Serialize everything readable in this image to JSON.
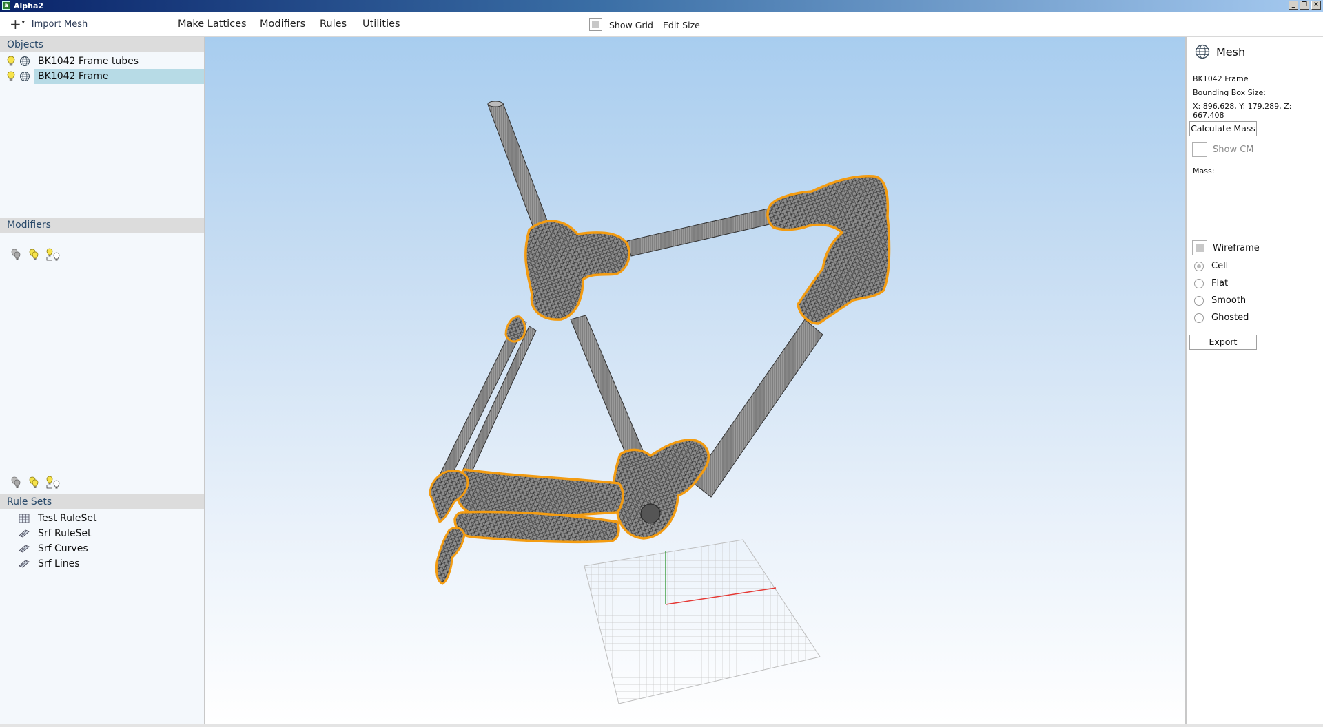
{
  "window": {
    "title": "Alpha2",
    "app_icon_letter": "a"
  },
  "toolbar": {
    "import_label": "Import Mesh",
    "menus": [
      "Make Lattices",
      "Modifiers",
      "Rules",
      "Utilities"
    ],
    "show_grid_label": "Show Grid",
    "edit_size_label": "Edit Size",
    "show_grid_checked": false
  },
  "objects": {
    "header": "Objects",
    "items": [
      {
        "name": "BK1042 Frame tubes",
        "selected": false
      },
      {
        "name": "BK1042 Frame",
        "selected": true
      }
    ]
  },
  "modifiers": {
    "header": "Modifiers"
  },
  "rule_sets": {
    "header": "Rule Sets",
    "items": [
      {
        "name": "Test RuleSet",
        "icon": "ruleset-grid-icon"
      },
      {
        "name": "Srf RuleSet",
        "icon": "surface-rule-icon"
      },
      {
        "name": "Srf Curves",
        "icon": "surface-rule-icon"
      },
      {
        "name": "Srf Lines",
        "icon": "surface-rule-icon"
      }
    ]
  },
  "properties": {
    "header": "Mesh",
    "object_name": "BK1042 Frame",
    "bbox_label": "Bounding Box Size:",
    "bbox_value": "X: 896.628, Y: 179.289, Z: 667.408",
    "calc_mass_label": "Calculate Mass",
    "show_cm_label": "Show CM",
    "mass_label": "Mass:",
    "wireframe_label": "Wireframe",
    "render_modes": [
      "Cell",
      "Flat",
      "Smooth",
      "Ghosted"
    ],
    "selected_render_mode": "Cell",
    "export_label": "Export"
  },
  "colors": {
    "selection_highlight": "#b7dbe6",
    "mesh_outline": "#f39c12",
    "axis_x": "#e53935",
    "axis_y": "#43a047"
  }
}
